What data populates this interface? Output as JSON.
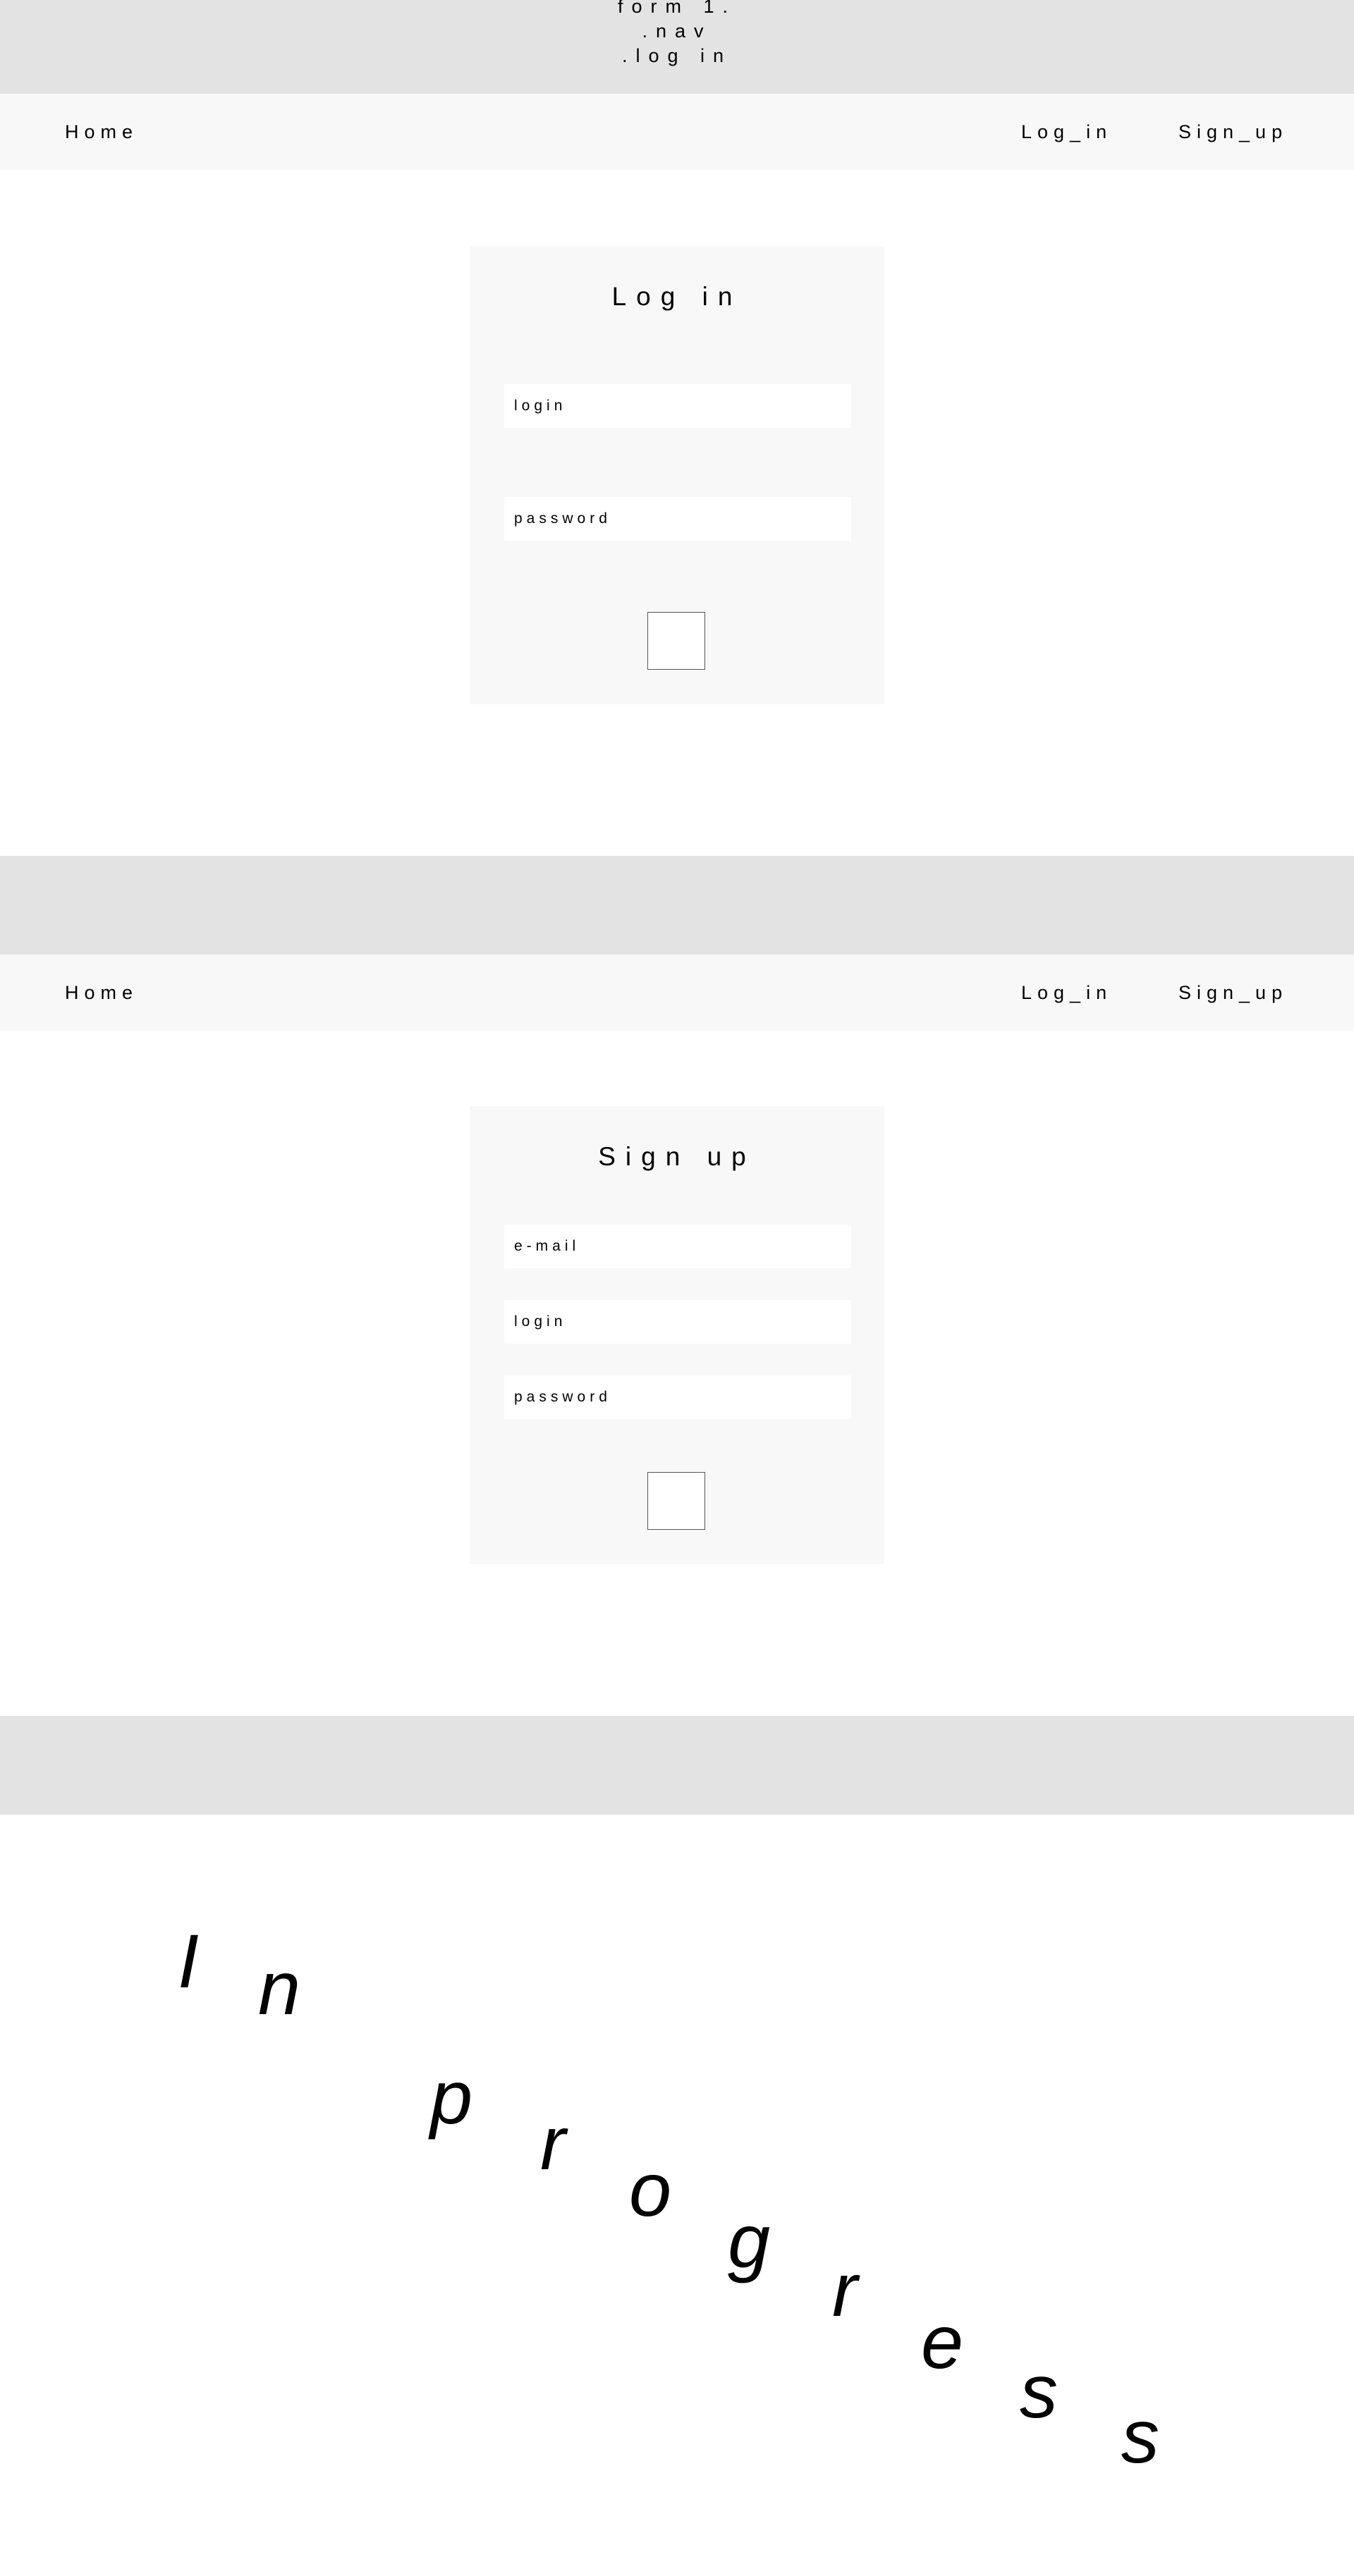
{
  "top_banner": {
    "lines": [
      "form 1.",
      ".nav",
      ".log in"
    ]
  },
  "nav": {
    "home_label": "Home",
    "login_label": "Log_in",
    "signup_label": "Sign_up"
  },
  "login_form": {
    "title": "Log in",
    "login_placeholder": "login",
    "password_placeholder": "password"
  },
  "signup_form": {
    "title": "Sign up",
    "email_placeholder": "e-mail",
    "login_placeholder": "login",
    "password_placeholder": "password"
  },
  "in_progress": {
    "letters": [
      "I",
      "n",
      "p",
      "r",
      "o",
      "g",
      "r",
      "e",
      "s",
      "s"
    ]
  }
}
